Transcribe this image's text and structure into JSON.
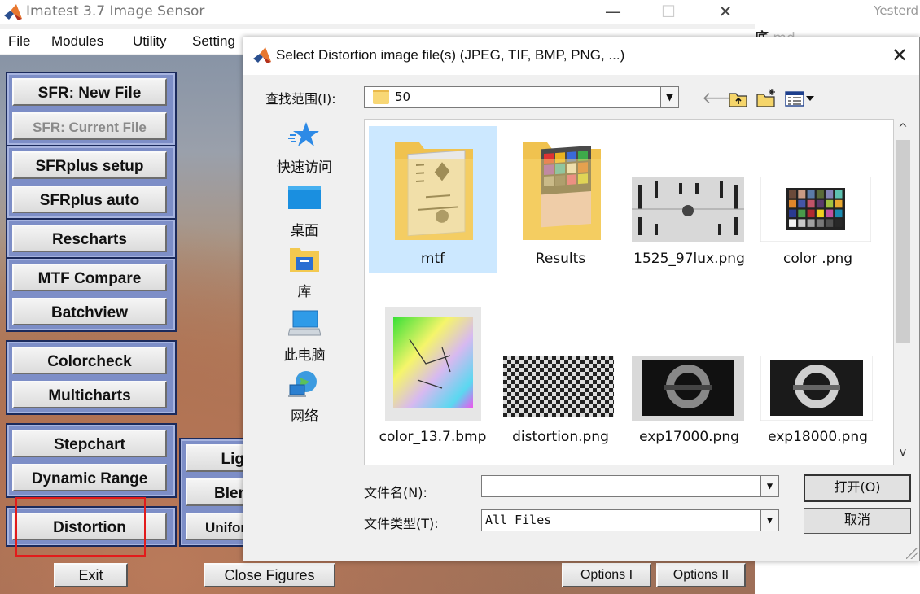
{
  "app": {
    "title": "Imatest 3.7  Image Sensor",
    "window_controls": {
      "minimize": "—",
      "maximize": "☐",
      "close": "✕"
    }
  },
  "menu": [
    "File",
    "Modules",
    "Utility",
    "Setting"
  ],
  "modules": {
    "sfr_new": "SFR: New File",
    "sfr_current": "SFR: Current File",
    "sfrplus_setup": "SFRplus  setup",
    "sfrplus_auto": "SFRplus  auto",
    "rescharts": "Rescharts",
    "mtf_compare": "MTF Compare",
    "batchview": "Batchview",
    "colorcheck": "Colorcheck",
    "multicharts": "Multicharts",
    "stepchart": "Stepchart",
    "dynamic_range": "Dynamic Range",
    "distortion": "Distortion",
    "light": "Lig",
    "blemish": "Bler",
    "uniformity": "Unifor"
  },
  "bottom_buttons": {
    "exit": "Exit",
    "close_figures": "Close Figures",
    "options1": "Options I",
    "options2": "Options II"
  },
  "background_window": {
    "yesterday": "Yesterd",
    "doc_name": "底",
    "doc_ext": ".md"
  },
  "dialog": {
    "title": "Select Distortion image file(s) (JPEG, TIF, BMP, PNG, ...)",
    "close": "✕",
    "look_in_label": "查找范围(I):",
    "look_in_value": "50",
    "toolbar_icons": [
      "back-arrow-icon",
      "up-folder-icon",
      "new-folder-icon",
      "view-menu-icon"
    ],
    "places": [
      "快速访问",
      "桌面",
      "库",
      "此电脑",
      "网络"
    ],
    "files": [
      {
        "name": "mtf",
        "kind": "folder-chart",
        "selected": true
      },
      {
        "name": "Results",
        "kind": "folder-color"
      },
      {
        "name": "1525_97lux.png",
        "kind": "resolution-chart"
      },
      {
        "name": "color .png",
        "kind": "color-chart"
      },
      {
        "name": "color_13.7.bmp",
        "kind": "gamut-chart"
      },
      {
        "name": "distortion.png",
        "kind": "checkerboard"
      },
      {
        "name": "exp17000.png",
        "kind": "step-chart-dark"
      },
      {
        "name": "exp18000.png",
        "kind": "step-chart-light"
      }
    ],
    "filename_label": "文件名(N):",
    "filename_value": "",
    "filetype_label": "文件类型(T):",
    "filetype_value": "All Files",
    "open_button": "打开(O)",
    "cancel_button": "取消"
  }
}
